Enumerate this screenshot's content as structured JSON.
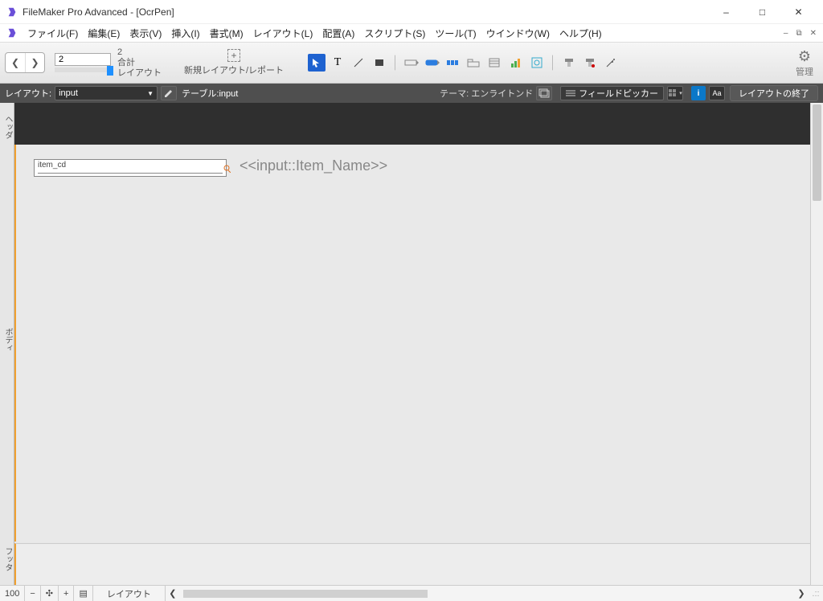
{
  "window": {
    "title": "FileMaker Pro Advanced - [OcrPen]"
  },
  "menu": {
    "file": "ファイル(F)",
    "edit": "編集(E)",
    "view": "表示(V)",
    "insert": "挿入(I)",
    "format": "書式(M)",
    "layout": "レイアウト(L)",
    "arrange": "配置(A)",
    "scripts": "スクリプト(S)",
    "tools": "ツール(T)",
    "window": "ウインドウ(W)",
    "help": "ヘルプ(H)"
  },
  "toolbar": {
    "record_value": "2",
    "record_total": "2",
    "total_label": "合計",
    "mode_label": "レイアウト",
    "newlayout_label": "新規レイアウト/レポート",
    "manage_label": "管理"
  },
  "layoutbar": {
    "layout_lbl": "レイアウト:",
    "layout_val": "input",
    "table_lbl": "テーブル:",
    "table_val": "input",
    "theme_lbl": "テーマ:",
    "theme_val": "エンライトンド",
    "fieldpicker": "フィールドピッカー",
    "info": "i",
    "aa": "Aa",
    "end": "レイアウトの終了"
  },
  "parts": {
    "header": "ヘッダ",
    "body": "ボディ",
    "footer": "フッタ"
  },
  "canvas": {
    "field_label": "item_cd",
    "merge_text": "<<input::Item_Name>>"
  },
  "status": {
    "zoom": "100",
    "mode": "レイアウト"
  }
}
